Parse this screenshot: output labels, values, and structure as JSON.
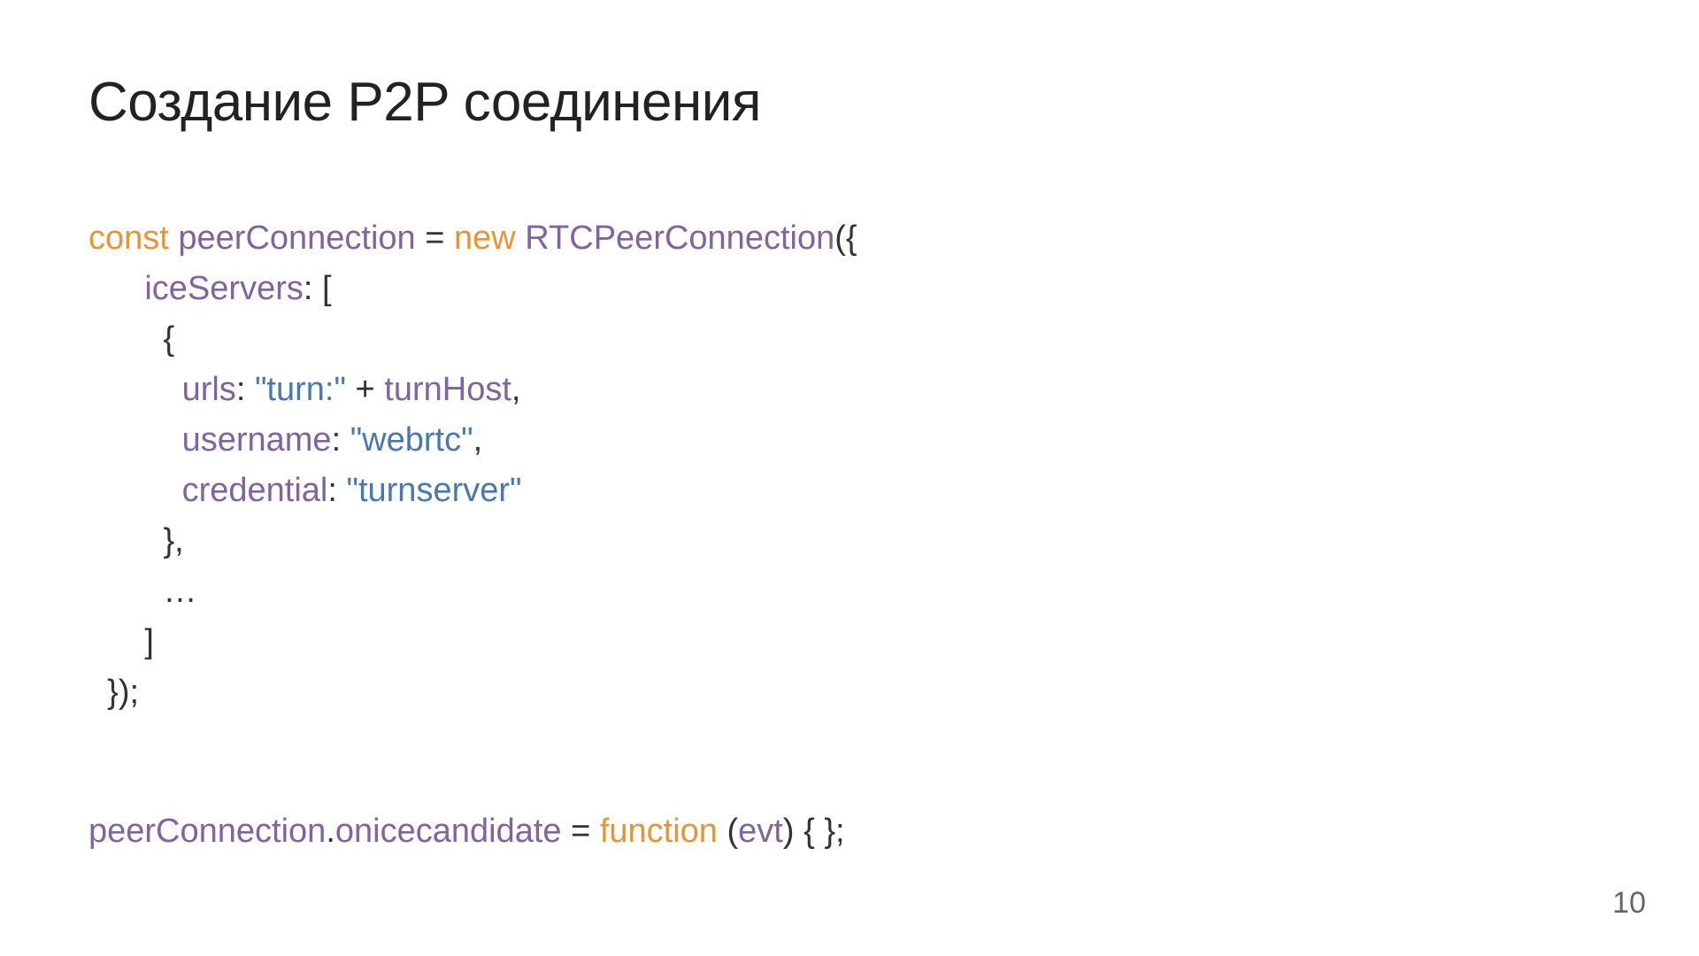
{
  "slide": {
    "title": "Создание P2P соединения",
    "pageNumber": "10"
  },
  "code": {
    "const": "const",
    "peerConnection": "peerConnection",
    "eq": " = ",
    "new": "new",
    "sp": " ",
    "RTCPeerConnection": "RTCPeerConnection",
    "openParenBrace": "({",
    "indent1": "      ",
    "iceServers": "iceServers",
    "colonBracket": ": [",
    "indent2": "        ",
    "openBrace": "{",
    "indent3": "          ",
    "urls": "urls",
    "colon": ": ",
    "strTurn": "\"turn:\"",
    "plus": " + ",
    "turnHost": "turnHost",
    "comma": ",",
    "username": "username",
    "strWebrtc": "\"webrtc\"",
    "credential": "credential",
    "strTurnserver": "\"turnserver\"",
    "closeBraceComma": "},",
    "ellipsis": "…",
    "closeBracket": "]",
    "indentEnd": "  ",
    "closeAll": "});",
    "dot": ".",
    "onicecandidate": "onicecandidate",
    "function": "function",
    "openParen": "(",
    "evt": "evt",
    "closeParen": ") ",
    "emptyBody": "{ };"
  }
}
